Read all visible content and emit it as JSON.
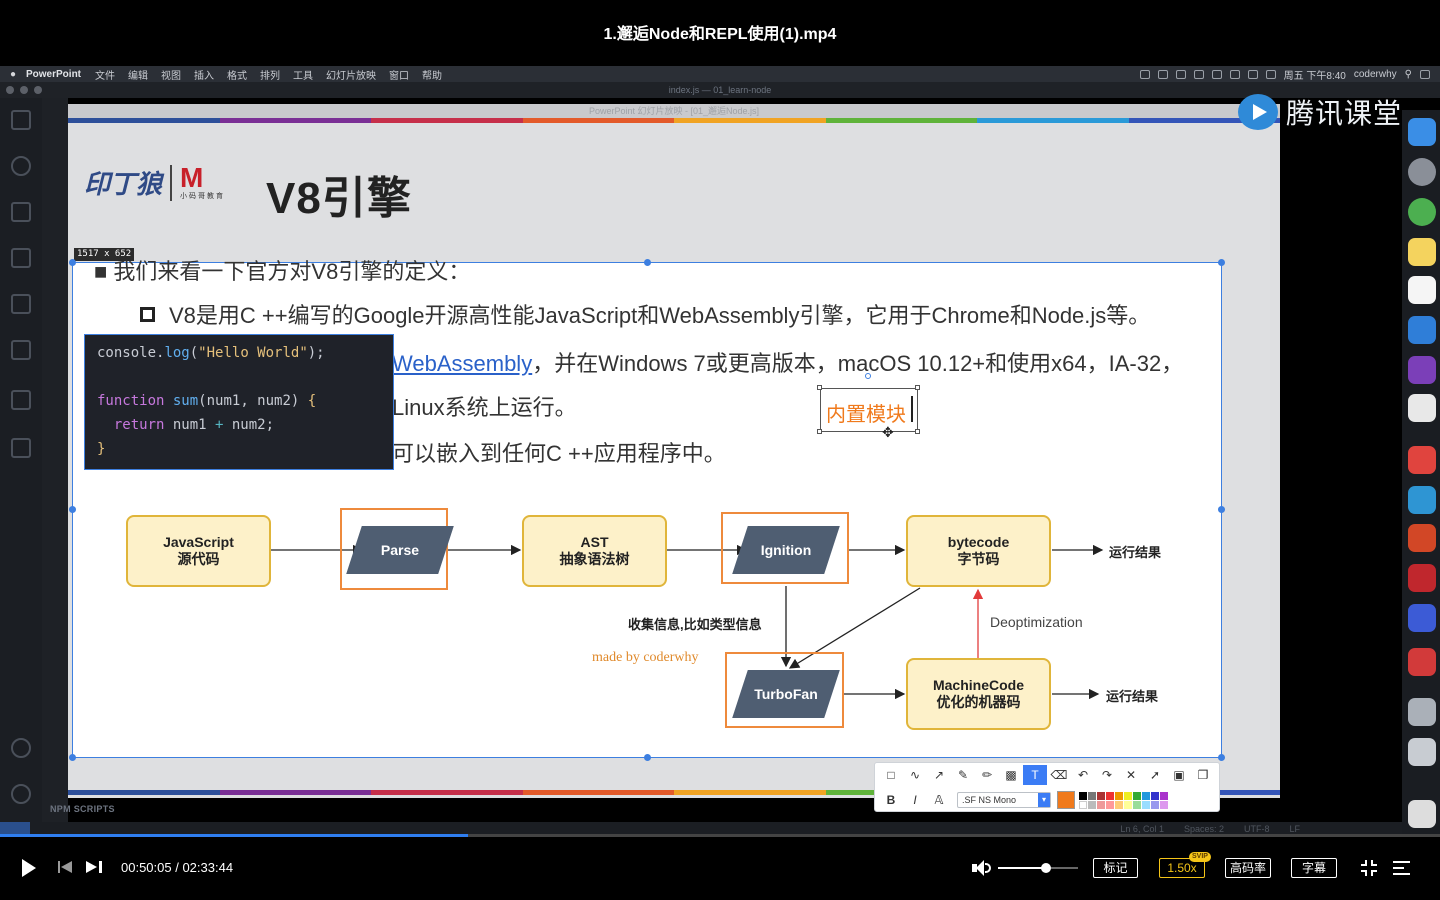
{
  "video": {
    "title": "1.邂逅Node和REPL使用(1).mp4"
  },
  "menubar": {
    "app": "PowerPoint",
    "items": [
      "文件",
      "编辑",
      "视图",
      "插入",
      "格式",
      "排列",
      "工具",
      "幻灯片放映",
      "窗口",
      "帮助"
    ],
    "clock": "周五 下午8:40",
    "user": "coderwhy"
  },
  "vscode": {
    "window_title": "index.js — 01_learn-node",
    "npm_scripts": "NPM SCRIPTS",
    "status_position": "Ln 6, Col 1",
    "status_spaces": "Spaces: 2",
    "status_encoding": "UTF-8",
    "status_eol": "LF"
  },
  "slide": {
    "window_title": "PowerPoint 幻灯片放映 - [01_邂逅Node.js]",
    "logo_text": "印丁狼",
    "logo_sub": "小码哥教育",
    "title": "V8引擎",
    "bullet_head": "我们来看一下官方对V8引擎的定义：",
    "line1": "V8是用C ++编写的Google开源高性能JavaScript和WebAssembly引擎，它用于Chrome和Node.js等。",
    "line2_link": "WebAssembly",
    "line2_rest": "，并在Windows 7或更高版本，macOS 10.12+和使用x64，IA-32，",
    "line3": "Linux系统上运行。",
    "line4": "可以嵌入到任何C ++应用程序中。"
  },
  "selection": {
    "size_label": "1517 x 652"
  },
  "code": {
    "l1_obj": "console.",
    "l1_fn": "log",
    "l1_str": "\"Hello World\"",
    "l3_kw": "function",
    "l3_fn": "sum",
    "l3_params": "num1, num2",
    "l4_kw": "return",
    "l4_a": " num1 ",
    "l4_op": "+",
    "l4_b": " num2;"
  },
  "annotation": {
    "text": "内置模块",
    "color": "#f07a1c"
  },
  "diagram": {
    "js_source_line1": "JavaScript",
    "js_source_line2": "源代码",
    "parse": "Parse",
    "ast_line1": "AST",
    "ast_line2": "抽象语法树",
    "ignition": "Ignition",
    "bytecode_line1": "bytecode",
    "bytecode_line2": "字节码",
    "result1": "运行结果",
    "collect_info": "收集信息,比如类型信息",
    "deoptimization": "Deoptimization",
    "made_by": "made by coderwhy",
    "turbofan": "TurboFan",
    "machine_line1": "MachineCode",
    "machine_line2": "优化的机器码",
    "result2": "运行结果"
  },
  "toolbar": {
    "bold": "B",
    "italic": "I",
    "font_name": ".SF NS Mono",
    "current_color": "#f07a1c"
  },
  "watermark": {
    "brand": "腾讯课堂"
  },
  "player": {
    "current_time": "00:50:05",
    "total_time": "02:33:44",
    "progress": 0.325,
    "volume": 0.6,
    "mark_label": "标记",
    "speed_label": "1.50x",
    "svip_badge": "SVIP",
    "quality_label": "高码率",
    "subtitle_label": "字幕"
  }
}
